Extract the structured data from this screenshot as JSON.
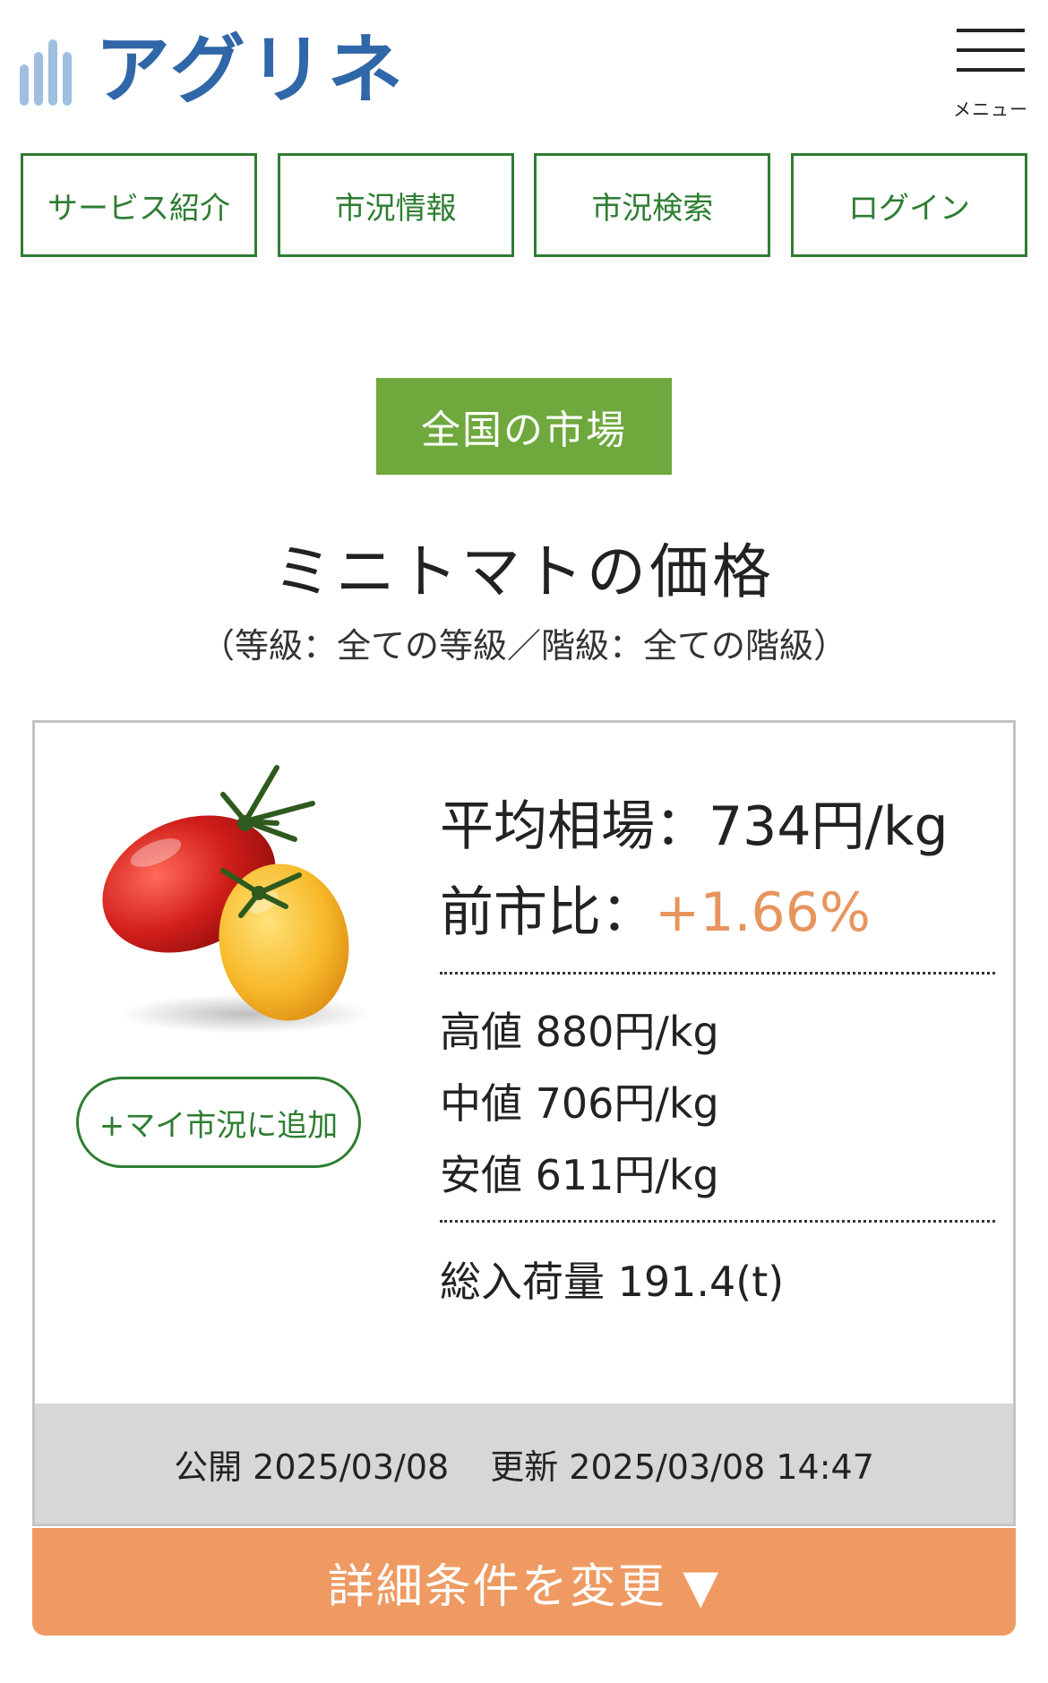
{
  "header": {
    "logo_text": "アグリネ",
    "menu_label": "メニュー"
  },
  "nav": [
    {
      "label": "サービス紹介"
    },
    {
      "label": "市況情報"
    },
    {
      "label": "市況検索"
    },
    {
      "label": "ログイン"
    }
  ],
  "category": "全国の市場",
  "title": "ミニトマトの価格",
  "subtitle": "（等級：全ての等級／階級：全ての階級）",
  "card": {
    "add_button": "+マイ市況に追加",
    "average_label": "平均相場：",
    "average_value": "734円/kg",
    "change_label": "前市比：",
    "change_value": "+1.66%",
    "high": "高値 880円/kg",
    "mid": "中値 706円/kg",
    "low": "安値 611円/kg",
    "volume": "総入荷量 191.4(t)",
    "published": "公開 2025/03/08",
    "updated": "更新 2025/03/08 14:47"
  },
  "change_conditions": "詳細条件を変更 ▼",
  "colors": {
    "brand_blue": "#2f67a8",
    "green": "#2e7d32",
    "category_green": "#6fa83d",
    "orange": "#ee9a62",
    "change_orange": "#e8945e"
  },
  "icons": {
    "logo": "bar-chart-logo-icon",
    "menu": "hamburger-menu-icon",
    "product": "mini-tomato-image"
  }
}
